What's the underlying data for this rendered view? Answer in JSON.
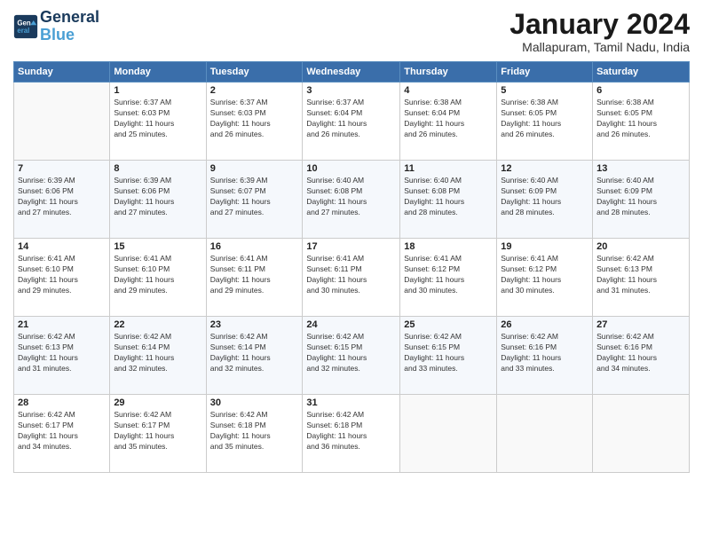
{
  "logo": {
    "line1": "General",
    "line2": "Blue"
  },
  "title": "January 2024",
  "location": "Mallapuram, Tamil Nadu, India",
  "days_header": [
    "Sunday",
    "Monday",
    "Tuesday",
    "Wednesday",
    "Thursday",
    "Friday",
    "Saturday"
  ],
  "weeks": [
    [
      {
        "num": "",
        "info": ""
      },
      {
        "num": "1",
        "info": "Sunrise: 6:37 AM\nSunset: 6:03 PM\nDaylight: 11 hours\nand 25 minutes."
      },
      {
        "num": "2",
        "info": "Sunrise: 6:37 AM\nSunset: 6:03 PM\nDaylight: 11 hours\nand 26 minutes."
      },
      {
        "num": "3",
        "info": "Sunrise: 6:37 AM\nSunset: 6:04 PM\nDaylight: 11 hours\nand 26 minutes."
      },
      {
        "num": "4",
        "info": "Sunrise: 6:38 AM\nSunset: 6:04 PM\nDaylight: 11 hours\nand 26 minutes."
      },
      {
        "num": "5",
        "info": "Sunrise: 6:38 AM\nSunset: 6:05 PM\nDaylight: 11 hours\nand 26 minutes."
      },
      {
        "num": "6",
        "info": "Sunrise: 6:38 AM\nSunset: 6:05 PM\nDaylight: 11 hours\nand 26 minutes."
      }
    ],
    [
      {
        "num": "7",
        "info": "Sunrise: 6:39 AM\nSunset: 6:06 PM\nDaylight: 11 hours\nand 27 minutes."
      },
      {
        "num": "8",
        "info": "Sunrise: 6:39 AM\nSunset: 6:06 PM\nDaylight: 11 hours\nand 27 minutes."
      },
      {
        "num": "9",
        "info": "Sunrise: 6:39 AM\nSunset: 6:07 PM\nDaylight: 11 hours\nand 27 minutes."
      },
      {
        "num": "10",
        "info": "Sunrise: 6:40 AM\nSunset: 6:08 PM\nDaylight: 11 hours\nand 27 minutes."
      },
      {
        "num": "11",
        "info": "Sunrise: 6:40 AM\nSunset: 6:08 PM\nDaylight: 11 hours\nand 28 minutes."
      },
      {
        "num": "12",
        "info": "Sunrise: 6:40 AM\nSunset: 6:09 PM\nDaylight: 11 hours\nand 28 minutes."
      },
      {
        "num": "13",
        "info": "Sunrise: 6:40 AM\nSunset: 6:09 PM\nDaylight: 11 hours\nand 28 minutes."
      }
    ],
    [
      {
        "num": "14",
        "info": "Sunrise: 6:41 AM\nSunset: 6:10 PM\nDaylight: 11 hours\nand 29 minutes."
      },
      {
        "num": "15",
        "info": "Sunrise: 6:41 AM\nSunset: 6:10 PM\nDaylight: 11 hours\nand 29 minutes."
      },
      {
        "num": "16",
        "info": "Sunrise: 6:41 AM\nSunset: 6:11 PM\nDaylight: 11 hours\nand 29 minutes."
      },
      {
        "num": "17",
        "info": "Sunrise: 6:41 AM\nSunset: 6:11 PM\nDaylight: 11 hours\nand 30 minutes."
      },
      {
        "num": "18",
        "info": "Sunrise: 6:41 AM\nSunset: 6:12 PM\nDaylight: 11 hours\nand 30 minutes."
      },
      {
        "num": "19",
        "info": "Sunrise: 6:41 AM\nSunset: 6:12 PM\nDaylight: 11 hours\nand 30 minutes."
      },
      {
        "num": "20",
        "info": "Sunrise: 6:42 AM\nSunset: 6:13 PM\nDaylight: 11 hours\nand 31 minutes."
      }
    ],
    [
      {
        "num": "21",
        "info": "Sunrise: 6:42 AM\nSunset: 6:13 PM\nDaylight: 11 hours\nand 31 minutes."
      },
      {
        "num": "22",
        "info": "Sunrise: 6:42 AM\nSunset: 6:14 PM\nDaylight: 11 hours\nand 32 minutes."
      },
      {
        "num": "23",
        "info": "Sunrise: 6:42 AM\nSunset: 6:14 PM\nDaylight: 11 hours\nand 32 minutes."
      },
      {
        "num": "24",
        "info": "Sunrise: 6:42 AM\nSunset: 6:15 PM\nDaylight: 11 hours\nand 32 minutes."
      },
      {
        "num": "25",
        "info": "Sunrise: 6:42 AM\nSunset: 6:15 PM\nDaylight: 11 hours\nand 33 minutes."
      },
      {
        "num": "26",
        "info": "Sunrise: 6:42 AM\nSunset: 6:16 PM\nDaylight: 11 hours\nand 33 minutes."
      },
      {
        "num": "27",
        "info": "Sunrise: 6:42 AM\nSunset: 6:16 PM\nDaylight: 11 hours\nand 34 minutes."
      }
    ],
    [
      {
        "num": "28",
        "info": "Sunrise: 6:42 AM\nSunset: 6:17 PM\nDaylight: 11 hours\nand 34 minutes."
      },
      {
        "num": "29",
        "info": "Sunrise: 6:42 AM\nSunset: 6:17 PM\nDaylight: 11 hours\nand 35 minutes."
      },
      {
        "num": "30",
        "info": "Sunrise: 6:42 AM\nSunset: 6:18 PM\nDaylight: 11 hours\nand 35 minutes."
      },
      {
        "num": "31",
        "info": "Sunrise: 6:42 AM\nSunset: 6:18 PM\nDaylight: 11 hours\nand 36 minutes."
      },
      {
        "num": "",
        "info": ""
      },
      {
        "num": "",
        "info": ""
      },
      {
        "num": "",
        "info": ""
      }
    ]
  ]
}
